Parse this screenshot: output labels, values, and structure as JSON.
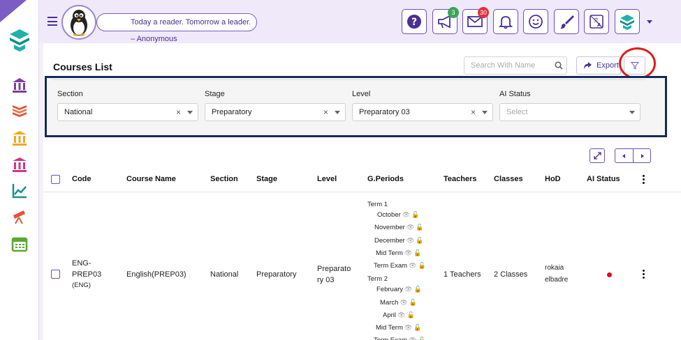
{
  "header": {
    "quote": "Today a reader. Tomorrow a leader. – Anonymous",
    "buttons": [
      {
        "name": "help-button",
        "icon": "question-icon"
      },
      {
        "name": "announcements-button",
        "icon": "megaphone-icon",
        "badge": "3",
        "badge_color": "#3aa655"
      },
      {
        "name": "messages-button",
        "icon": "envelope-icon",
        "badge": "30",
        "badge_color": "#e0303a"
      },
      {
        "name": "notifications-button",
        "icon": "bell-icon"
      },
      {
        "name": "feedback-button",
        "icon": "smiley-icon"
      },
      {
        "name": "theme-button",
        "icon": "paintbrush-icon"
      },
      {
        "name": "language-button",
        "icon": "translate-icon"
      },
      {
        "name": "platform-button",
        "icon": "stack-logo-icon"
      }
    ]
  },
  "sidebar": {
    "icons": [
      "school-icon",
      "books-icon",
      "institution-icon",
      "building-icon",
      "chart-icon",
      "telescope-icon",
      "calendar-icon"
    ]
  },
  "page": {
    "title": "Courses List",
    "search_placeholder": "Search With Name",
    "export_label": "Export"
  },
  "filters": [
    {
      "label": "Section",
      "value": "National",
      "clearable": true
    },
    {
      "label": "Stage",
      "value": "Preparatory",
      "clearable": true
    },
    {
      "label": "Level",
      "value": "Preparatory 03",
      "clearable": true
    },
    {
      "label": "AI Status",
      "value": "",
      "placeholder": "Select",
      "clearable": false
    }
  ],
  "table": {
    "headers": {
      "code": "Code",
      "course_name": "Course Name",
      "section": "Section",
      "stage": "Stage",
      "level": "Level",
      "periods": "G.Periods",
      "teachers": "Teachers",
      "classes": "Classes",
      "hod": "HoD",
      "ai_status": "AI Status"
    },
    "row": {
      "code_line1": "ENG-",
      "code_line2": "PREP03",
      "code_sub": "(ENG)",
      "course_name": "English(PREP03)",
      "section": "National",
      "stage": "Preparatory",
      "level_line1": "Preparato",
      "level_line2": "ry 03",
      "teachers": "1 Teachers",
      "classes": "2 Classes",
      "hod_line1": "rokaia",
      "hod_line2": "elbadre",
      "ai_status_color": "#d90f1b",
      "periods": [
        {
          "text": "Term 1",
          "indent": false
        },
        {
          "text": "October",
          "indent": true
        },
        {
          "text": "November",
          "indent": true
        },
        {
          "text": "December",
          "indent": true
        },
        {
          "text": "Mid Term",
          "indent": true
        },
        {
          "text": "Term Exam",
          "indent": true
        },
        {
          "text": "Term 2",
          "indent": false
        },
        {
          "text": "February",
          "indent": true
        },
        {
          "text": "March",
          "indent": true
        },
        {
          "text": "April",
          "indent": true
        },
        {
          "text": "Mid Term",
          "indent": true
        },
        {
          "text": "Term Exam",
          "indent": true
        }
      ]
    }
  },
  "colors": {
    "accent": "#6f4fb9",
    "highlight_ring": "#e21a1a",
    "filter_border": "#162a5a"
  }
}
